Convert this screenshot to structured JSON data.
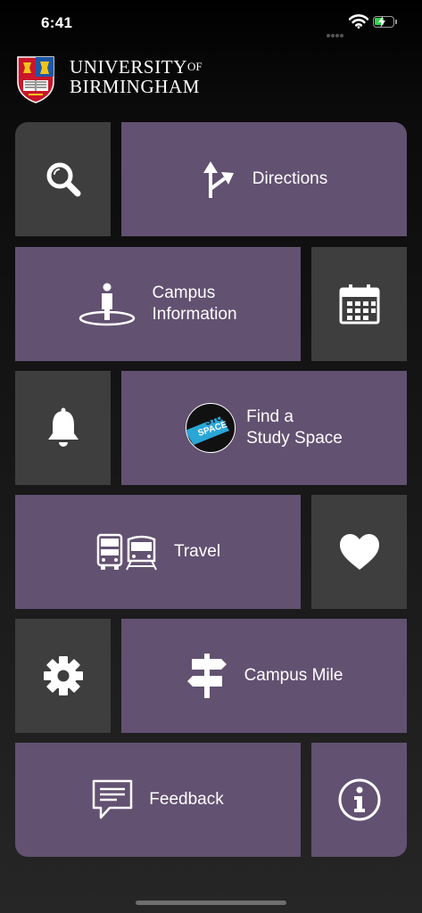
{
  "status_bar": {
    "time": "6:41"
  },
  "brand": {
    "line1": "UNIVERSITY",
    "of": "OF",
    "line2": "BIRMINGHAM"
  },
  "tiles": {
    "search": {
      "icon": "search-icon"
    },
    "directions": {
      "label": "Directions",
      "icon": "directions-arrow-icon"
    },
    "campus_info": {
      "label": "Campus\nInformation",
      "icon": "person-location-icon"
    },
    "calendar": {
      "icon": "calendar-icon"
    },
    "notifications": {
      "icon": "bell-icon"
    },
    "study_space": {
      "label": "Find a\nStudy Space",
      "badge_line1": "STUDY",
      "badge_line2": "SPACE",
      "icon": "study-space-badge-icon"
    },
    "travel": {
      "label": "Travel",
      "icon": "bus-train-icon"
    },
    "favourites": {
      "icon": "heart-icon"
    },
    "settings": {
      "icon": "gear-icon"
    },
    "campus_mile": {
      "label": "Campus Mile",
      "icon": "signpost-icon"
    },
    "feedback": {
      "label": "Feedback",
      "icon": "speech-bubble-icon"
    },
    "info": {
      "icon": "info-icon"
    }
  },
  "colors": {
    "accent_purple": "#625171",
    "tile_gray": "#3e3e3e",
    "background": "#000000"
  }
}
